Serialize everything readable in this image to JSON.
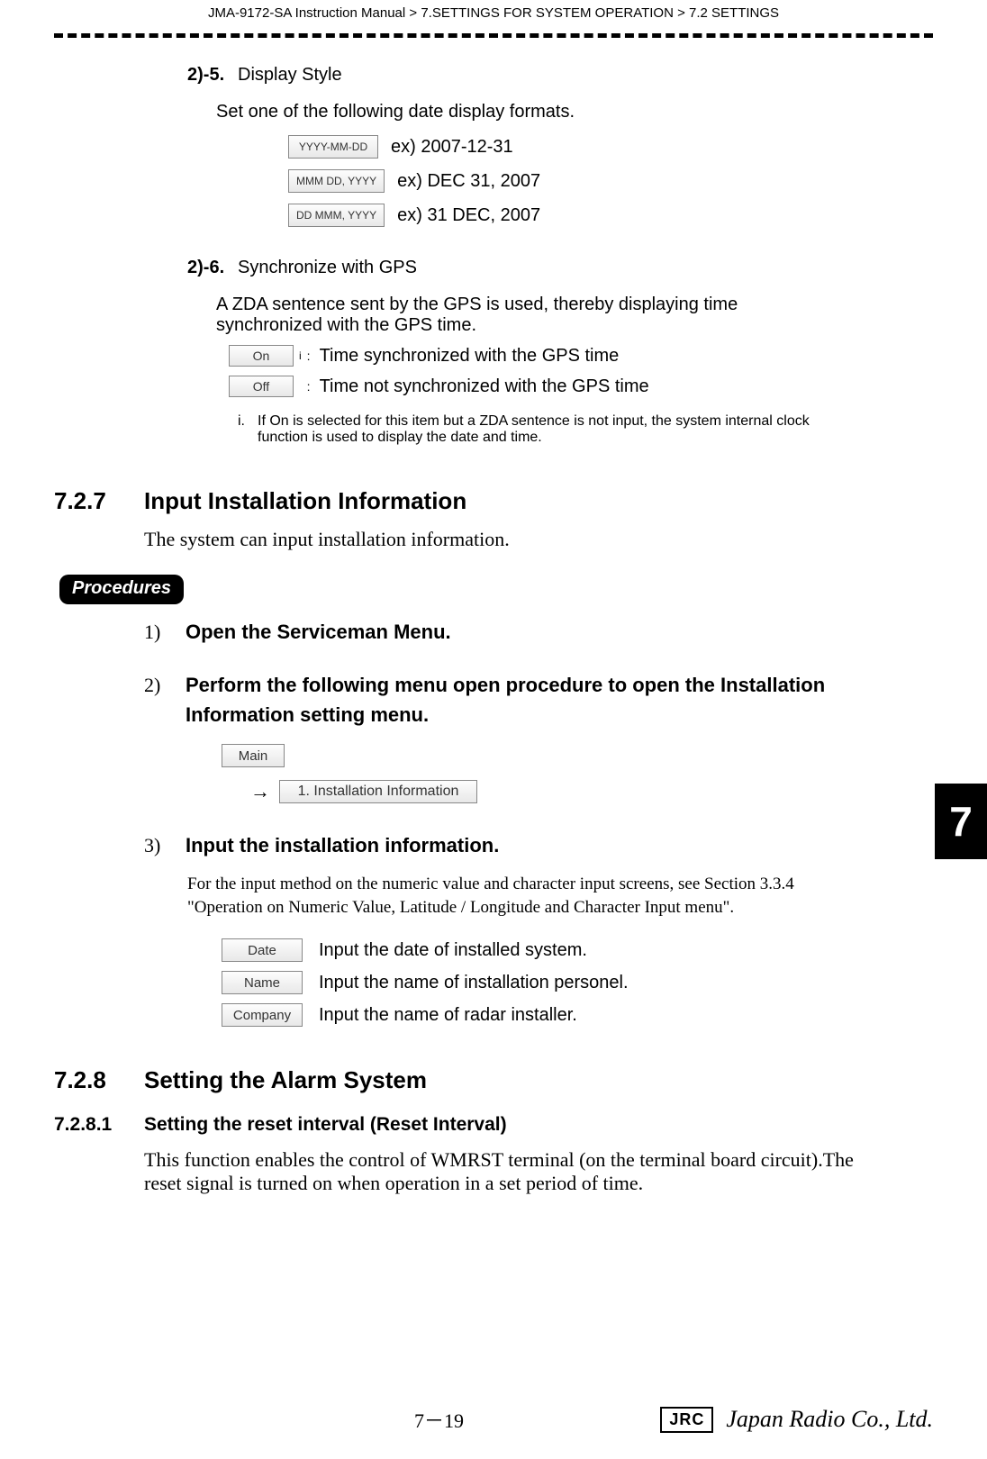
{
  "header": {
    "breadcrumb": "JMA-9172-SA Instruction Manual > 7.SETTINGS FOR SYSTEM OPERATION > 7.2  SETTINGS"
  },
  "s25": {
    "num": "2)-5.",
    "title": "Display Style",
    "intro": "Set one of the following date display formats.",
    "opts": [
      {
        "btn": "YYYY-MM-DD",
        "desc": "ex) 2007-12-31"
      },
      {
        "btn": "MMM DD, YYYY",
        "desc": "ex) DEC 31, 2007"
      },
      {
        "btn": "DD MMM, YYYY",
        "desc": "ex) 31 DEC, 2007"
      }
    ]
  },
  "s26": {
    "num": "2)-6.",
    "title": "Synchronize with GPS",
    "intro": "A ZDA sentence sent by the GPS is used, thereby displaying time synchronized with the GPS time.",
    "on": {
      "btn": "On",
      "sup": "i",
      "desc": "Time synchronized with the GPS time"
    },
    "off": {
      "btn": "Off",
      "desc": "Time not synchronized with the GPS time"
    },
    "footnote_mark": "i.",
    "footnote": "If  On  is selected for this item but a ZDA sentence is not input, the system internal clock function is used to display the date and time."
  },
  "s727": {
    "num": "7.2.7",
    "title": "Input Installation Information",
    "intro": "The system can input installation information."
  },
  "procedures_label": "Procedures",
  "steps": {
    "s1": {
      "n": "1)",
      "t": "Open the Serviceman Menu."
    },
    "s2": {
      "n": "2)",
      "t": "Perform the following menu open procedure to open the Installation Information setting menu."
    },
    "main_btn": "Main",
    "arrow": "→",
    "menu_btn": "1. Installation Information",
    "s3": {
      "n": "3)",
      "t": "Input the installation information."
    },
    "s3note": "For the input method on the numeric value and character input screens, see Section 3.3.4 \"Operation on Numeric Value, Latitude / Longitude and Character Input menu\".",
    "fields": [
      {
        "btn": "Date",
        "desc": "Input the date of installed system."
      },
      {
        "btn": "Name",
        "desc": "Input the name of installation personel."
      },
      {
        "btn": "Company",
        "desc": "Input the name of radar installer."
      }
    ]
  },
  "s728": {
    "num": "7.2.8",
    "title": "Setting the Alarm System"
  },
  "s7281": {
    "num": "7.2.8.1",
    "title": "Setting the reset interval (Reset Interval)",
    "body": "This function enables the control of WMRST terminal (on the terminal board circuit).The reset signal is turned on when operation in a set period of time."
  },
  "sidetab": "7",
  "footer": {
    "page": "7－19",
    "jrc_box": "JRC",
    "jrc_script": "Japan Radio Co., Ltd."
  }
}
